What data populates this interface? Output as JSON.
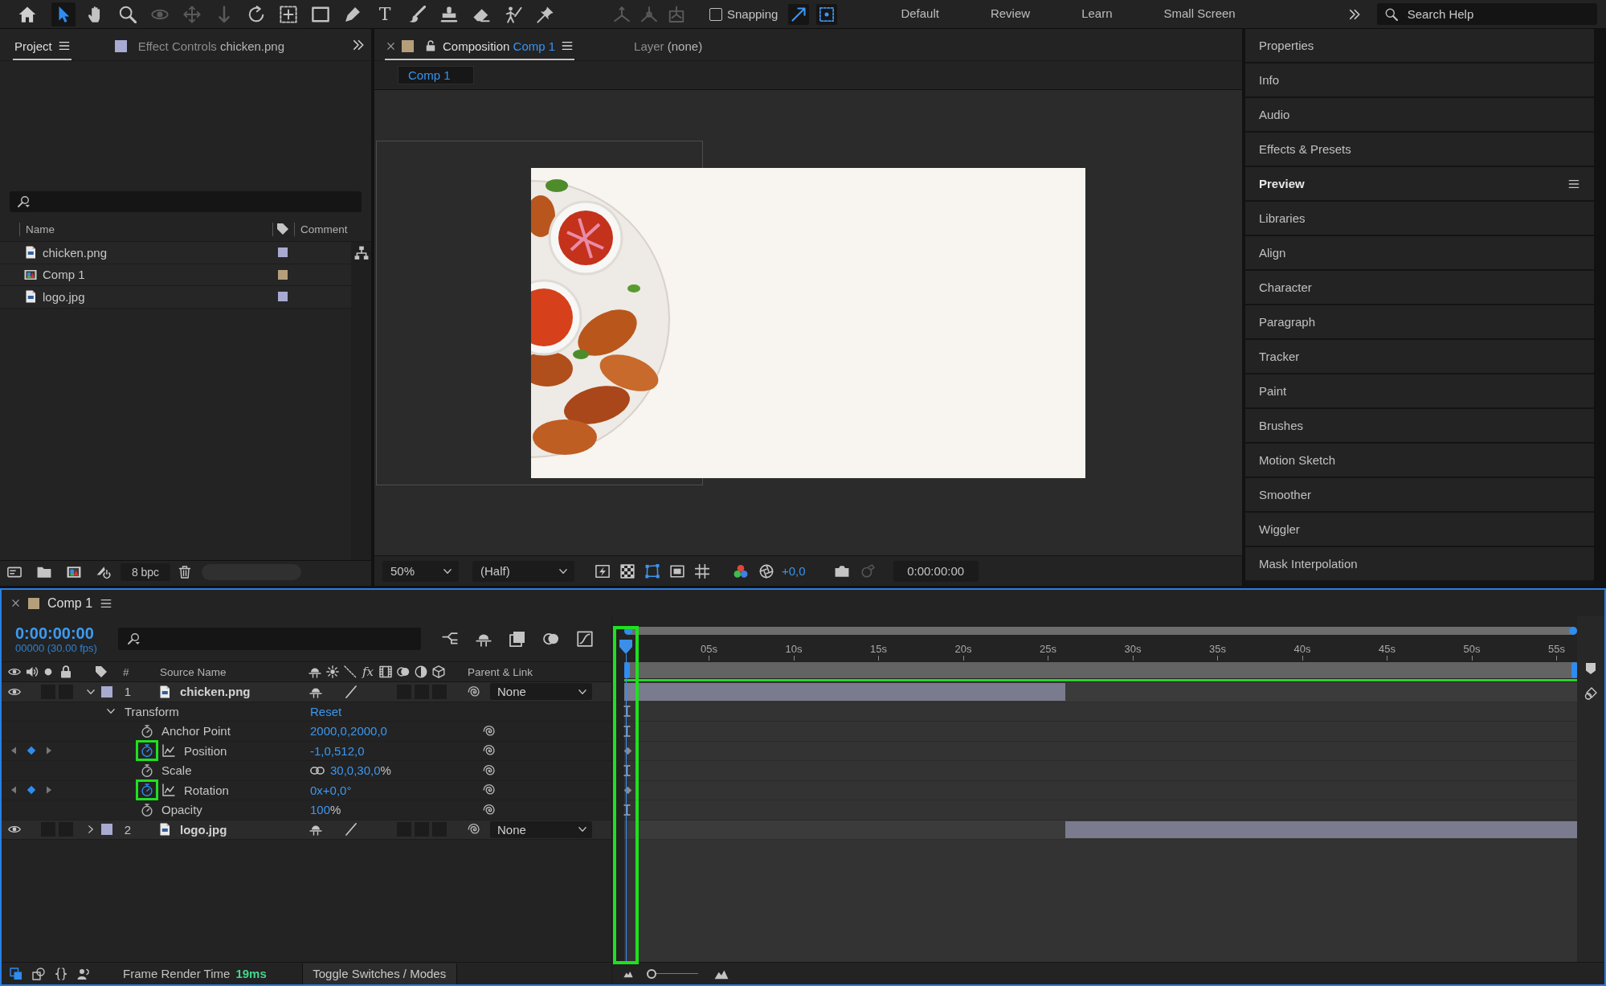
{
  "toolbar": {
    "tools": [
      {
        "selected": true,
        "disabled": false
      },
      {
        "selected": false,
        "disabled": false
      },
      {
        "selected": false,
        "disabled": false
      },
      {
        "selected": false,
        "disabled": true
      },
      {
        "selected": false,
        "disabled": true
      },
      {
        "selected": false,
        "disabled": true
      },
      {
        "selected": false,
        "disabled": false
      },
      {
        "selected": false,
        "disabled": false
      },
      {
        "selected": false,
        "disabled": false
      },
      {
        "selected": false,
        "disabled": false
      },
      {
        "selected": false,
        "disabled": false,
        "glyph": "T"
      },
      {
        "selected": false,
        "disabled": false
      },
      {
        "selected": false,
        "disabled": false
      },
      {
        "selected": false,
        "disabled": false
      },
      {
        "selected": false,
        "disabled": false
      },
      {
        "selected": false,
        "disabled": false
      }
    ],
    "axis_modes": [
      {
        "disabled": true
      },
      {
        "disabled": true
      },
      {
        "disabled": true
      }
    ],
    "snapping": {
      "label": "Snapping",
      "checked": false
    },
    "snap_options": [
      {
        "on": true
      },
      {
        "on": true
      }
    ],
    "workspaces": [
      {
        "label": "Default",
        "selected": false
      },
      {
        "label": "Review",
        "selected": false
      },
      {
        "label": "Learn",
        "selected": false
      },
      {
        "label": "Small Screen",
        "selected": false
      }
    ],
    "search": {
      "placeholder": "Search Help"
    }
  },
  "project_panel": {
    "tabs": [
      {
        "label": "Project",
        "selected": true
      },
      {
        "label": "Effect Controls",
        "target": "chicken.png",
        "color": "#a9aad2",
        "selected": false
      }
    ],
    "columns": {
      "name": "Name",
      "comment": "Comment"
    },
    "items": [
      {
        "name": "chicken.png",
        "kind": "footage",
        "color": "#a9aad2",
        "selected": false
      },
      {
        "name": "Comp 1",
        "kind": "composition",
        "color": "#b59f7b",
        "selected": false
      },
      {
        "name": "logo.jpg",
        "kind": "footage",
        "color": "#a9aad2",
        "selected": false
      }
    ],
    "bit_depth": "8 bpc"
  },
  "composition_panel": {
    "tabs": [
      {
        "label": "Composition",
        "target": "Comp 1",
        "color": "#b59f7b",
        "locked": false,
        "selected": true
      },
      {
        "label": "Layer",
        "target": "(none)",
        "selected": false
      }
    ],
    "breadcrumb": "Comp 1",
    "viewer": {
      "zoom": "50%",
      "resolution": "(Half)",
      "exposure": "+0,0",
      "timecode": "0:00:00:00"
    }
  },
  "side_panels": [
    {
      "label": "Properties",
      "selected": false
    },
    {
      "label": "Info",
      "selected": false
    },
    {
      "label": "Audio",
      "selected": false
    },
    {
      "label": "Effects & Presets",
      "selected": false
    },
    {
      "label": "Preview",
      "selected": true
    },
    {
      "label": "Libraries",
      "selected": false
    },
    {
      "label": "Align",
      "selected": false
    },
    {
      "label": "Character",
      "selected": false
    },
    {
      "label": "Paragraph",
      "selected": false
    },
    {
      "label": "Tracker",
      "selected": false
    },
    {
      "label": "Paint",
      "selected": false
    },
    {
      "label": "Brushes",
      "selected": false
    },
    {
      "label": "Motion Sketch",
      "selected": false
    },
    {
      "label": "Smoother",
      "selected": false
    },
    {
      "label": "Wiggler",
      "selected": false
    },
    {
      "label": "Mask Interpolation",
      "selected": false
    }
  ],
  "timeline": {
    "tab": {
      "label": "Comp 1",
      "color": "#b59f7b"
    },
    "timecode": "0:00:00:00",
    "frame_info": "00000 (30.00 fps)",
    "columns": {
      "number": "#",
      "source_name": "Source Name",
      "effects": "fx",
      "parent": "Parent & Link"
    },
    "layers": [
      {
        "index": "1",
        "name": "chicken.png",
        "color": "#a9aad2",
        "visible": true,
        "expanded": true,
        "parent": "None",
        "children": [
          {
            "name": "Transform",
            "action": "Reset",
            "expanded": true,
            "children": [
              {
                "name": "Anchor Point",
                "value": "2000,0,2000,0",
                "keyframed": false,
                "linked": false,
                "highlighted": false
              },
              {
                "name": "Position",
                "value": "-1,0,512,0",
                "keyframed": true,
                "linked": false,
                "highlighted": true
              },
              {
                "name": "Scale",
                "value": "30,0,30,0",
                "unit": "%",
                "keyframed": false,
                "linked": true,
                "highlighted": false
              },
              {
                "name": "Rotation",
                "value": "0x+0,0°",
                "keyframed": true,
                "linked": false,
                "highlighted": true
              },
              {
                "name": "Opacity",
                "value": "100",
                "unit": "%",
                "keyframed": false,
                "linked": false,
                "highlighted": false
              }
            ]
          }
        ]
      },
      {
        "index": "2",
        "name": "logo.jpg",
        "color": "#a9aad2",
        "visible": true,
        "expanded": false,
        "parent": "None"
      }
    ],
    "ruler": [
      "05s",
      "10s",
      "15s",
      "20s",
      "25s",
      "30s",
      "35s",
      "40s",
      "45s",
      "50s",
      "55s"
    ],
    "zoom_slider": {
      "level": 0
    },
    "frame_render_time": {
      "label": "Frame Render Time",
      "value": "19ms"
    },
    "mode_toggle": "Toggle Switches / Modes"
  }
}
